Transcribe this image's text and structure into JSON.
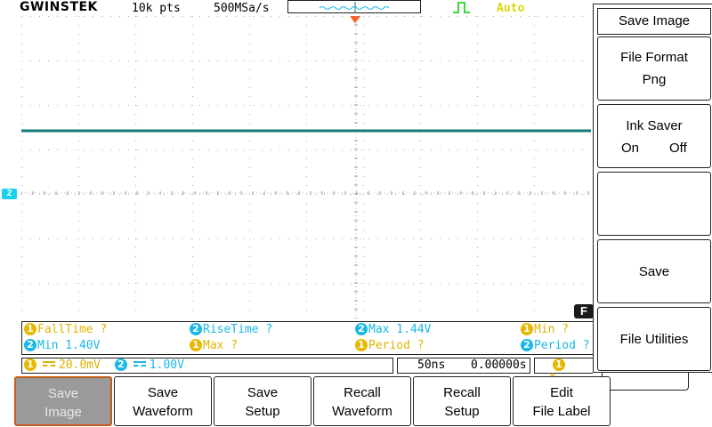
{
  "header": {
    "logo": "GWINSTEK",
    "record_length": "10k pts",
    "sample_rate": "500MSa/s",
    "trigger_mode": "Auto",
    "trigger_edge_icon": "rising-edge-icon",
    "trigger_mode_color": "#d8d80a"
  },
  "channels": {
    "ch2_marker": "2",
    "ch1_color": "#e0b300",
    "ch2_color": "#1ab8e6",
    "trace_color": "#147a78",
    "function_marker": "F"
  },
  "measurements": [
    {
      "channel": "1",
      "text": "FallTime ?"
    },
    {
      "channel": "2",
      "text": "RiseTime ?"
    },
    {
      "channel": "2",
      "text": "Max 1.44V"
    },
    {
      "channel": "1",
      "text": "Min ?"
    },
    {
      "channel": "2",
      "text": "Min 1.40V"
    },
    {
      "channel": "1",
      "text": "Max ?"
    },
    {
      "channel": "1",
      "text": "Period ?"
    },
    {
      "channel": "2",
      "text": "Period ?"
    }
  ],
  "status": {
    "ch1_num": "1",
    "ch1_scale": "20.0mV",
    "ch2_num": "2",
    "ch2_scale": "1.00V",
    "timebase": "50ns",
    "horizontal_position": "0.00000s",
    "trigger_source": "1"
  },
  "side_menu": {
    "title": "Save Image",
    "file_format_label": "File Format",
    "file_format_value": "Png",
    "ink_saver_label": "Ink Saver",
    "ink_saver_on": "On",
    "ink_saver_off": "Off",
    "save_label": "Save",
    "file_utilities_label": "File Utilities"
  },
  "bottom_menu": [
    {
      "l1": "Save",
      "l2": "Image"
    },
    {
      "l1": "Save",
      "l2": "Waveform"
    },
    {
      "l1": "Save",
      "l2": "Setup"
    },
    {
      "l1": "Recall",
      "l2": "Waveform"
    },
    {
      "l1": "Recall",
      "l2": "Setup"
    },
    {
      "l1": "Edit",
      "l2": "File Label"
    }
  ]
}
